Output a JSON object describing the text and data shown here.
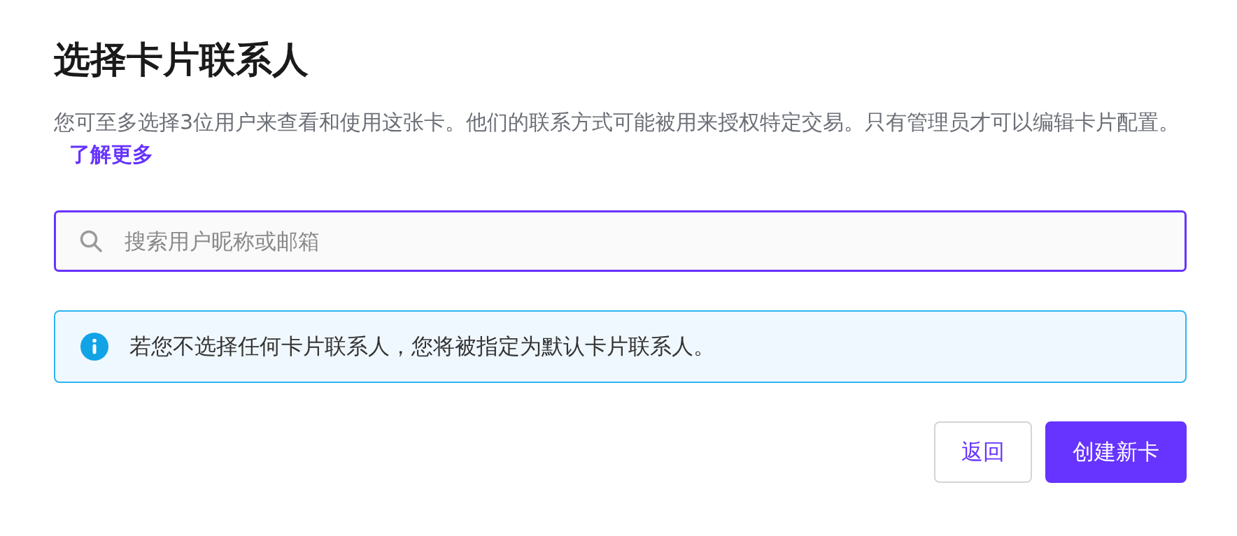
{
  "title": "选择卡片联系人",
  "description": "您可至多选择3位用户来查看和使用这张卡。他们的联系方式可能被用来授权特定交易。只有管理员才可以编辑卡片配置。",
  "learn_more_link": "了解更多",
  "search": {
    "placeholder": "搜索用户昵称或邮箱"
  },
  "notice": {
    "kind": "info",
    "text": "若您不选择任何卡片联系人，您将被指定为默认卡片联系人。"
  },
  "buttons": [
    {
      "label": "返回",
      "kind": "secondary"
    },
    {
      "label": "创建新卡",
      "kind": "primary"
    }
  ]
}
